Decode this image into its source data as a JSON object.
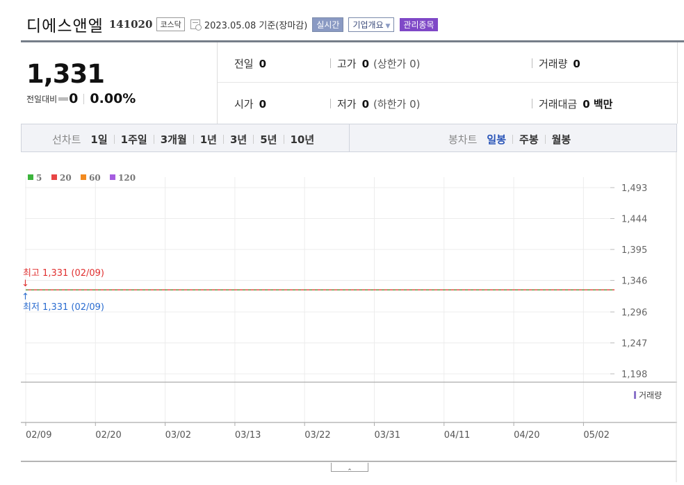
{
  "header": {
    "name": "디에스앤엘",
    "code": "141020",
    "market": "코스닥",
    "date_text": "2023.05.08 기준(장마감)",
    "realtime_btn": "실시간",
    "company_btn": "기업개요",
    "managed_btn": "관리종목"
  },
  "summary": {
    "price": "1,331",
    "change_label": "전일대비",
    "change_value": "0",
    "change_pct": "0.00%",
    "prev_label": "전일",
    "prev_value": "0",
    "high_label": "고가",
    "high_value": "0",
    "upper_limit": "(상한가 0)",
    "volume_label": "거래량",
    "volume_value": "0",
    "open_label": "시가",
    "open_value": "0",
    "low_label": "저가",
    "low_value": "0",
    "lower_limit": "(하한가 0)",
    "amount_label": "거래대금",
    "amount_value": "0 백만"
  },
  "toolbar": {
    "line_label": "선차트",
    "periods": [
      "1일",
      "1주일",
      "3개월",
      "1년",
      "3년",
      "5년",
      "10년"
    ],
    "candle_label": "봉차트",
    "candles": [
      "일봉",
      "주봉",
      "월봉"
    ],
    "active_candle": "일봉"
  },
  "chart_data": {
    "type": "line",
    "legend": [
      "5",
      "20",
      "60",
      "120"
    ],
    "legend_colors": [
      "#3cb43c",
      "#e84545",
      "#f28a1f",
      "#a55de0"
    ],
    "x_labels": [
      "02/09",
      "02/20",
      "03/02",
      "03/13",
      "03/22",
      "03/31",
      "04/11",
      "04/20",
      "05/02"
    ],
    "y_ticks": [
      "1,493",
      "1,444",
      "1,395",
      "1,346",
      "1,296",
      "1,247",
      "1,198"
    ],
    "y_range": [
      1198,
      1493
    ],
    "price_value": 1331,
    "high_annotation": "최고 1,331 (02/09)",
    "low_annotation": "최저 1,331 (02/09)",
    "high_color": "#e03030",
    "low_color": "#2a6cd0",
    "volume_label": "거래량"
  },
  "controls": {
    "collapse_icon": "chevron-up-icon"
  }
}
